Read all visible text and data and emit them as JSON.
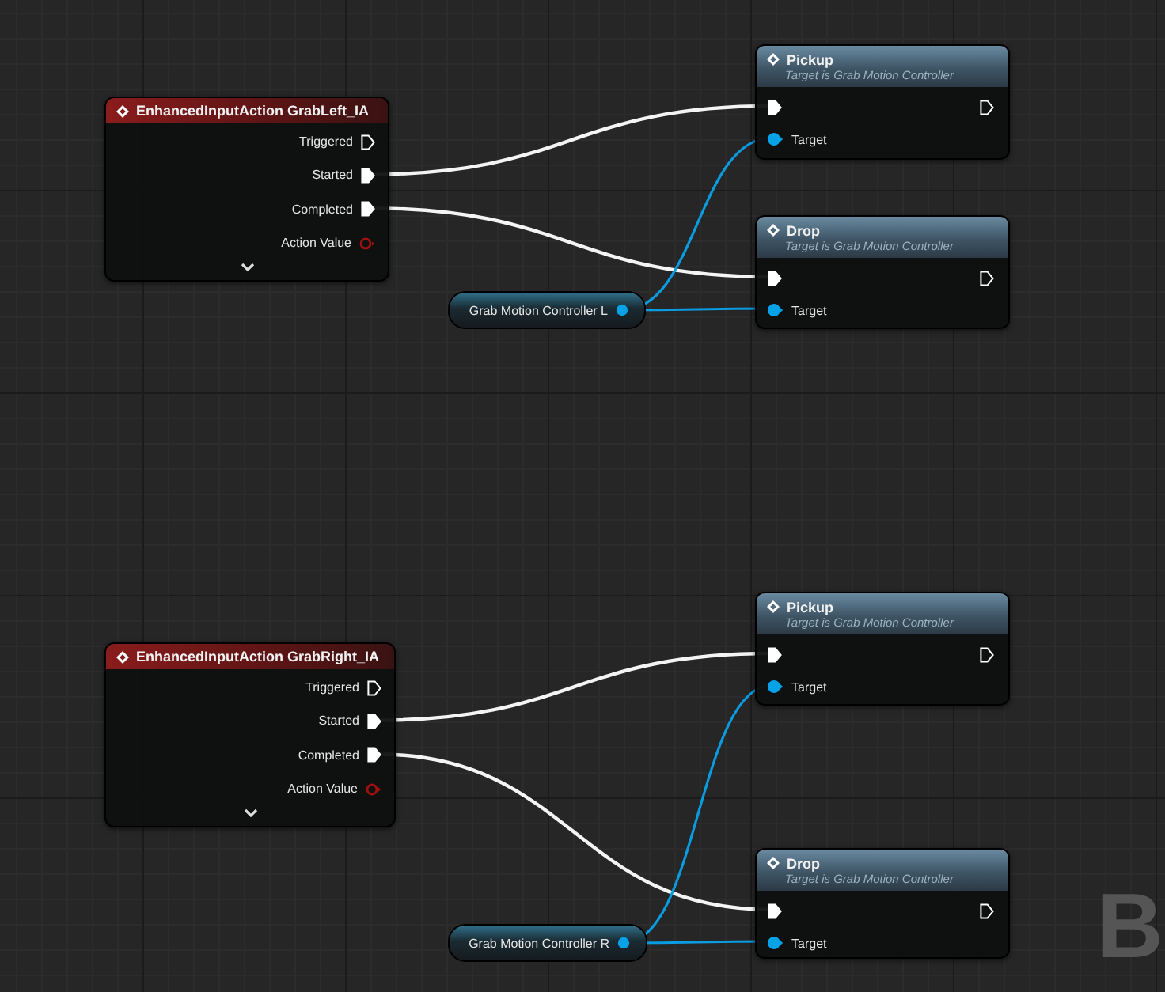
{
  "graph": {
    "event_nodes": [
      {
        "title": "EnhancedInputAction GrabLeft_IA",
        "pins": [
          {
            "label": "Triggered",
            "kind": "exec",
            "connected": false
          },
          {
            "label": "Started",
            "kind": "exec",
            "connected": true
          },
          {
            "label": "Completed",
            "kind": "exec",
            "connected": true
          },
          {
            "label": "Action Value",
            "kind": "value",
            "connected": false
          }
        ]
      },
      {
        "title": "EnhancedInputAction GrabRight_IA",
        "pins": [
          {
            "label": "Triggered",
            "kind": "exec",
            "connected": false
          },
          {
            "label": "Started",
            "kind": "exec",
            "connected": true
          },
          {
            "label": "Completed",
            "kind": "exec",
            "connected": true
          },
          {
            "label": "Action Value",
            "kind": "value",
            "connected": false
          }
        ]
      }
    ],
    "function_nodes": [
      {
        "title": "Pickup",
        "subtitle": "Target is Grab Motion Controller",
        "pins": [
          {
            "kind": "exec_in",
            "connected": true
          },
          {
            "kind": "exec_out",
            "connected": false
          },
          {
            "kind": "object",
            "label": "Target",
            "connected": true
          }
        ]
      },
      {
        "title": "Drop",
        "subtitle": "Target is Grab Motion Controller",
        "pins": [
          {
            "kind": "exec_in",
            "connected": true
          },
          {
            "kind": "exec_out",
            "connected": false
          },
          {
            "kind": "object",
            "label": "Target",
            "connected": true
          }
        ]
      },
      {
        "title": "Pickup",
        "subtitle": "Target is Grab Motion Controller",
        "pins": [
          {
            "kind": "exec_in",
            "connected": true
          },
          {
            "kind": "exec_out",
            "connected": false
          },
          {
            "kind": "object",
            "label": "Target",
            "connected": true
          }
        ]
      },
      {
        "title": "Drop",
        "subtitle": "Target is Grab Motion Controller",
        "pins": [
          {
            "kind": "exec_in",
            "connected": true
          },
          {
            "kind": "exec_out",
            "connected": false
          },
          {
            "kind": "object",
            "label": "Target",
            "connected": true
          }
        ]
      }
    ],
    "variable_nodes": [
      {
        "label": "Grab Motion Controller L"
      },
      {
        "label": "Grab Motion Controller R"
      }
    ],
    "watermark": "B"
  }
}
